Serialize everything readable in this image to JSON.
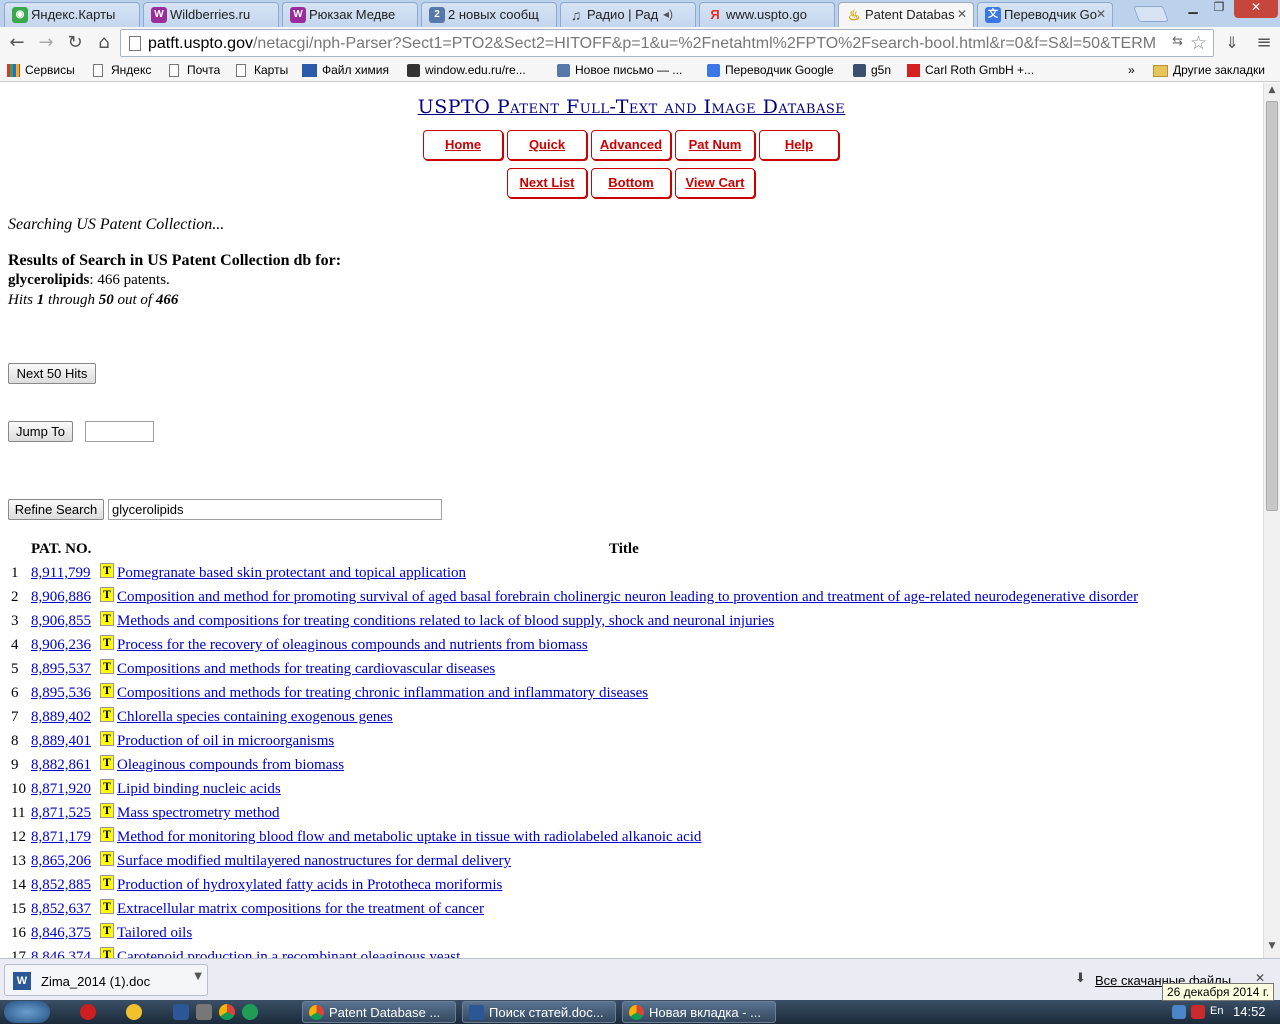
{
  "browser": {
    "tabs": [
      {
        "label": "Яндекс.Карты",
        "icon": "yandex-maps-icon",
        "color": "#39a84a"
      },
      {
        "label": "Wildberries.ru",
        "icon": "wildberries-icon",
        "color": "#9b2d9a"
      },
      {
        "label": "Рюкзак Медве",
        "icon": "wildberries-icon",
        "color": "#9b2d9a"
      },
      {
        "label": "2 новых сообщ",
        "icon": "mail-icon",
        "color": "#5578a8"
      },
      {
        "label": "Радио | Рад",
        "icon": "music-note-icon",
        "color": "#444444"
      },
      {
        "label": "www.uspto.go",
        "icon": "yandex-icon",
        "color": "#e0312b"
      },
      {
        "label": "Patent Databas",
        "icon": "lightbulb-icon",
        "color": "#d4a400"
      },
      {
        "label": "Переводчик Go",
        "icon": "translate-icon",
        "color": "#3b78e7"
      }
    ],
    "url_host": "patft.uspto.gov",
    "url_path": "/netacgi/nph-Parser?Sect1=PTO2&Sect2=HITOFF&p=1&u=%2Fnetahtml%2FPTO%2Fsearch-bool.html&r=0&f=S&l=50&TERM",
    "bookmarks": [
      {
        "label": "Сервисы",
        "icon": "apps-grid-icon",
        "color": "#d63a2c"
      },
      {
        "label": "Яндекс",
        "icon": "page-icon",
        "color": "#ffffff"
      },
      {
        "label": "Почта",
        "icon": "page-icon",
        "color": "#ffffff"
      },
      {
        "label": "Карты",
        "icon": "page-icon",
        "color": "#ffffff"
      },
      {
        "label": "Файл химия",
        "icon": "chem-icon",
        "color": "#2a5aa8"
      },
      {
        "label": "window.edu.ru/re...",
        "icon": "window-edu-icon",
        "color": "#333333"
      },
      {
        "label": "Новое письмо — ...",
        "icon": "mail-icon",
        "color": "#5578a8"
      },
      {
        "label": "Переводчик Google",
        "icon": "translate-icon",
        "color": "#3b78e7"
      },
      {
        "label": "g5n",
        "icon": "play-icon",
        "color": "#3b4f6e"
      },
      {
        "label": "Carl Roth GmbH +...",
        "icon": "carl-roth-icon",
        "color": "#d62020"
      }
    ],
    "bookmarks_overflow": "»",
    "other_bookmarks": "Другие закладки"
  },
  "page": {
    "site_title": "USPTO Patent Full-Text and Image Database",
    "nav_row1": [
      "Home",
      "Quick",
      "Advanced",
      "Pat Num",
      "Help"
    ],
    "nav_row2": [
      "Next List",
      "Bottom",
      "View Cart"
    ],
    "searching": "Searching US Patent Collection...",
    "results_heading": "Results of Search in US Patent Collection db for:",
    "query_term": "glycerolipids",
    "query_count": ": 466 patents.",
    "hits": {
      "prefix": "Hits ",
      "from": "1",
      "mid": " through ",
      "to": "50",
      "out": " out of ",
      "total": "466"
    },
    "next_button": "Next 50 Hits",
    "jump_button": "Jump To",
    "jump_value": "",
    "refine_button": "Refine Search",
    "refine_value": "glycerolipids",
    "col_patno": "PAT. NO.",
    "col_title": "Title",
    "title_icon_letter": "T",
    "results": [
      {
        "n": "1",
        "pat": "8,911,799",
        "title": "Pomegranate based skin protectant and topical application"
      },
      {
        "n": "2",
        "pat": "8,906,886",
        "title": "Composition and method for promoting survival of aged basal forebrain cholinergic neuron leading to provention and treatment of age-related neurodegenerative disorder"
      },
      {
        "n": "3",
        "pat": "8,906,855",
        "title": "Methods and compositions for treating conditions related to lack of blood supply, shock and neuronal injuries"
      },
      {
        "n": "4",
        "pat": "8,906,236",
        "title": "Process for the recovery of oleaginous compounds and nutrients from biomass"
      },
      {
        "n": "5",
        "pat": "8,895,537",
        "title": "Compositions and methods for treating cardiovascular diseases"
      },
      {
        "n": "6",
        "pat": "8,895,536",
        "title": "Compositions and methods for treating chronic inflammation and inflammatory diseases"
      },
      {
        "n": "7",
        "pat": "8,889,402",
        "title": "Chlorella species containing exogenous genes"
      },
      {
        "n": "8",
        "pat": "8,889,401",
        "title": "Production of oil in microorganisms"
      },
      {
        "n": "9",
        "pat": "8,882,861",
        "title": "Oleaginous compounds from biomass"
      },
      {
        "n": "10",
        "pat": "8,871,920",
        "title": "Lipid binding nucleic acids"
      },
      {
        "n": "11",
        "pat": "8,871,525",
        "title": "Mass spectrometry method"
      },
      {
        "n": "12",
        "pat": "8,871,179",
        "title": "Method for monitoring blood flow and metabolic uptake in tissue with radiolabeled alkanoic acid"
      },
      {
        "n": "13",
        "pat": "8,865,206",
        "title": "Surface modified multilayered nanostructures for dermal delivery"
      },
      {
        "n": "14",
        "pat": "8,852,885",
        "title": "Production of hydroxylated fatty acids in Prototheca moriformis"
      },
      {
        "n": "15",
        "pat": "8,852,637",
        "title": "Extracellular matrix compositions for the treatment of cancer"
      },
      {
        "n": "16",
        "pat": "8,846,375",
        "title": "Tailored oils"
      },
      {
        "n": "17",
        "pat": "8,846,374",
        "title": "Carotenoid production in a recombinant oleaginous yeast"
      }
    ]
  },
  "downloads": {
    "file": "Zima_2014 (1).doc",
    "all_label": "Все скачанные файлы"
  },
  "taskbar": {
    "tasks": [
      {
        "label": "Patent Database ...",
        "icon": "chrome-icon"
      },
      {
        "label": "Поиск статей.doc...",
        "icon": "word-icon"
      },
      {
        "label": "Новая вкладка - ...",
        "icon": "chrome-icon"
      }
    ],
    "lang": "En",
    "time": "14:52",
    "date_tooltip": "26 декабря 2014 г."
  },
  "colors": {
    "link": "#0000cc",
    "nav_red": "#cc0000",
    "title_navy": "#000080"
  }
}
